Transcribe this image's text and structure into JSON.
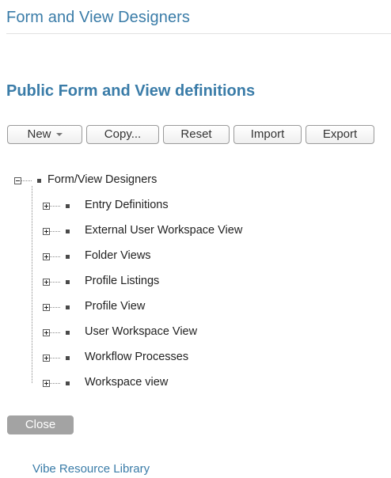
{
  "header": {
    "title": "Form and View Designers"
  },
  "section": {
    "title": "Public Form and View definitions"
  },
  "toolbar": {
    "new_label": "New",
    "copy_label": "Copy...",
    "reset_label": "Reset",
    "import_label": "Import",
    "export_label": "Export"
  },
  "tree": {
    "root": {
      "label": "Form/View Designers",
      "expanded": true
    },
    "children": [
      {
        "label": "Entry Definitions",
        "expanded": false
      },
      {
        "label": "External User Workspace View",
        "expanded": false
      },
      {
        "label": "Folder Views",
        "expanded": false
      },
      {
        "label": "Profile Listings",
        "expanded": false
      },
      {
        "label": "Profile View",
        "expanded": false
      },
      {
        "label": "User Workspace View",
        "expanded": false
      },
      {
        "label": "Workflow Processes",
        "expanded": false
      },
      {
        "label": "Workspace view",
        "expanded": false
      }
    ]
  },
  "footer": {
    "close_label": "Close",
    "resource_link": "Vibe Resource Library"
  }
}
